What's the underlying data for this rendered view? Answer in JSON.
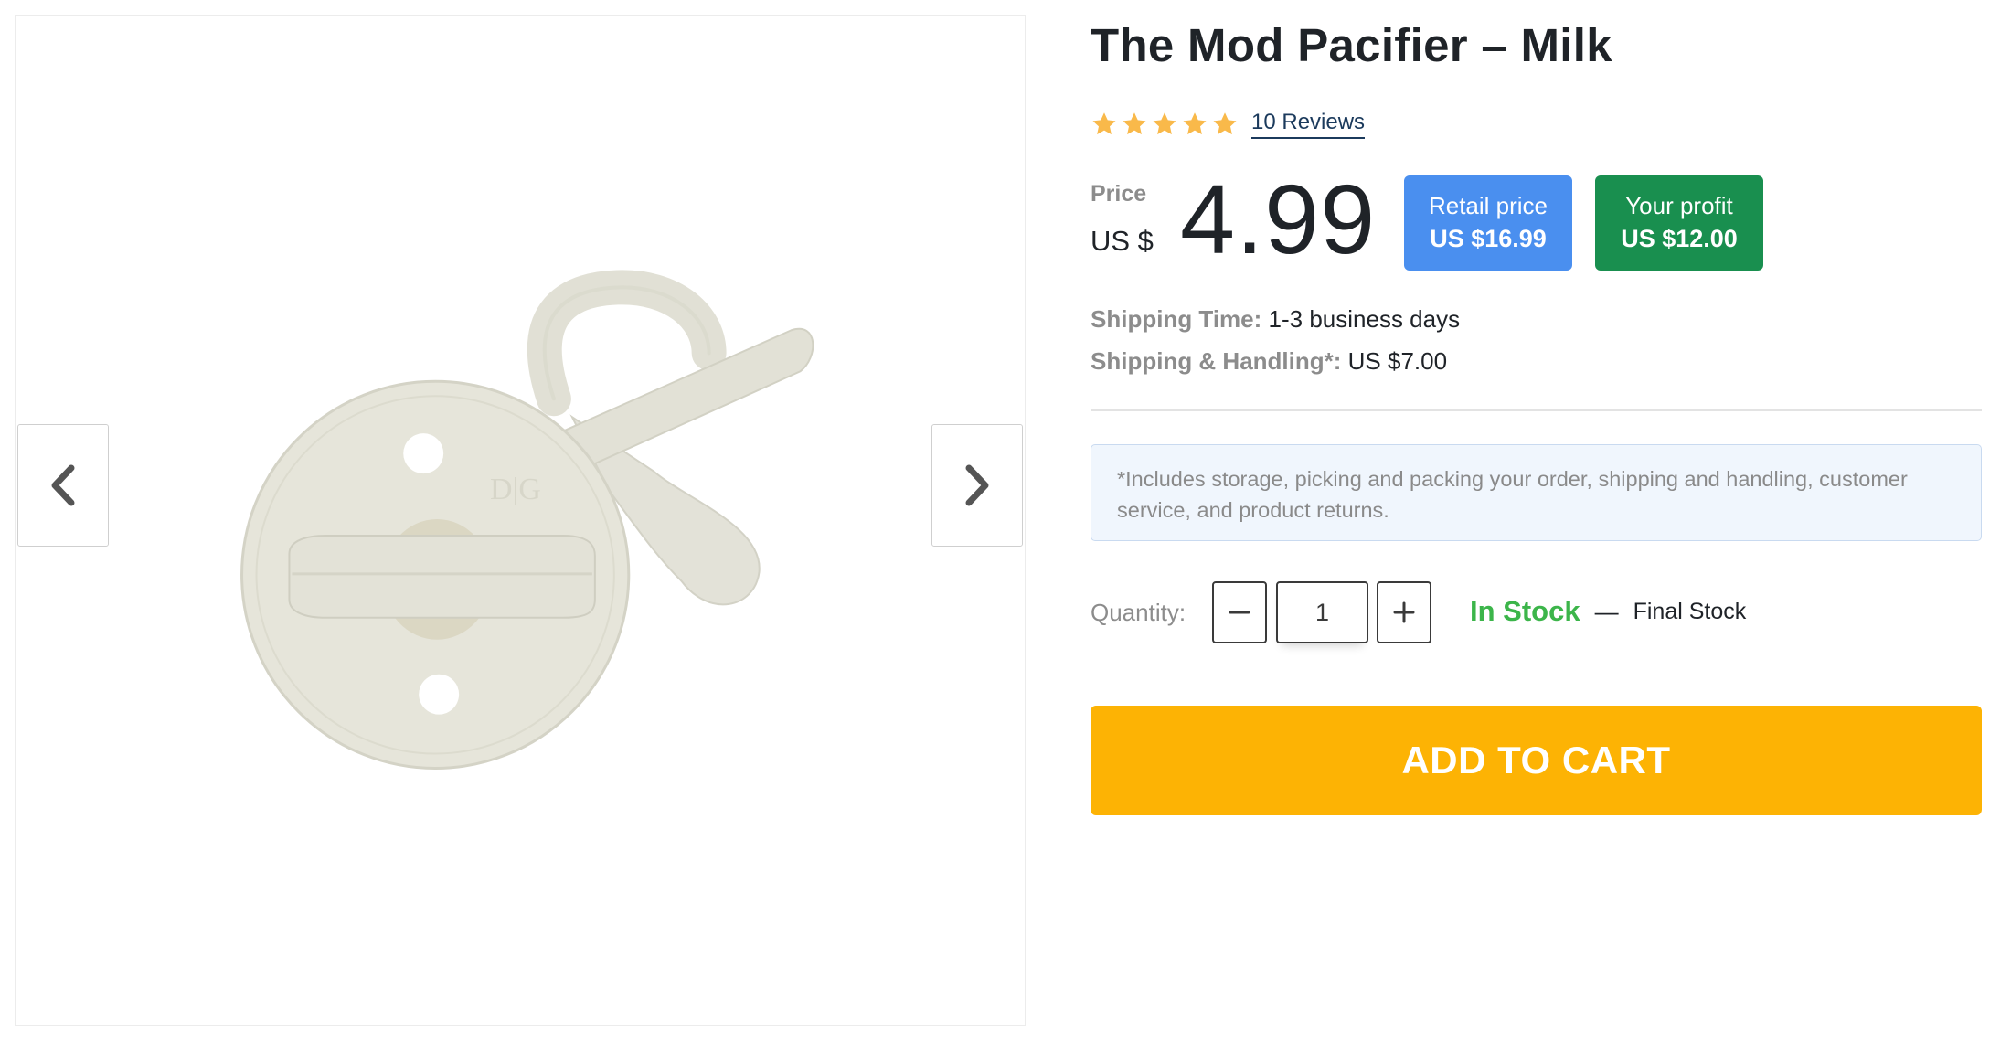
{
  "product": {
    "title": "The Mod Pacifier – Milk",
    "rating": 5,
    "reviews_label": "10 Reviews",
    "image_name": "pacifier-milk",
    "logo_text": "D|G"
  },
  "pricing": {
    "label": "Price",
    "currency": "US $",
    "value": "4.99",
    "retail_label": "Retail price",
    "retail_value": "US $16.99",
    "profit_label": "Your profit",
    "profit_value": "US $12.00"
  },
  "shipping": {
    "time_label": "Shipping Time:",
    "time_value": "1-3 business days",
    "handling_label": "Shipping & Handling*:",
    "handling_value": "US $7.00",
    "note": "*Includes storage, picking and packing your order, shipping and handling, customer service, and product returns."
  },
  "quantity": {
    "label": "Quantity:",
    "value": "1",
    "minus_icon": "minus-icon",
    "plus_icon": "plus-icon"
  },
  "stock": {
    "status": "In Stock",
    "dash": "—",
    "note": "Final Stock"
  },
  "cart": {
    "button_label": "ADD TO CART"
  },
  "colors": {
    "star": "#f9b94a",
    "retail_badge": "#4a8fef",
    "profit_badge": "#198f4f",
    "in_stock": "#3cb54a",
    "cart_button": "#fdb304",
    "note_bg": "#f0f6fd"
  },
  "icons": {
    "prev": "chevron-left-icon",
    "next": "chevron-right-icon",
    "star": "star-icon"
  }
}
